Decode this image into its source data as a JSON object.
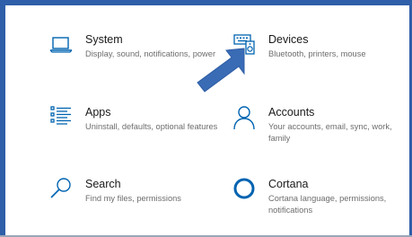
{
  "settings": {
    "tiles": [
      {
        "title": "System",
        "description": "Display, sound, notifications, power",
        "icon": "laptop-icon"
      },
      {
        "title": "Devices",
        "description": "Bluetooth, printers, mouse",
        "icon": "devices-icon"
      },
      {
        "title": "Apps",
        "description": "Uninstall, defaults, optional features",
        "icon": "apps-list-icon"
      },
      {
        "title": "Accounts",
        "description": "Your accounts, email, sync, work, family",
        "icon": "person-icon"
      },
      {
        "title": "Search",
        "description": "Find my files, permissions",
        "icon": "search-icon"
      },
      {
        "title": "Cortana",
        "description": "Cortana language, permissions, notifications",
        "icon": "cortana-ring-icon"
      }
    ]
  },
  "colors": {
    "accent": "#0063b1",
    "arrow": "#3a6bb5",
    "frame": "#2f5fa8"
  }
}
